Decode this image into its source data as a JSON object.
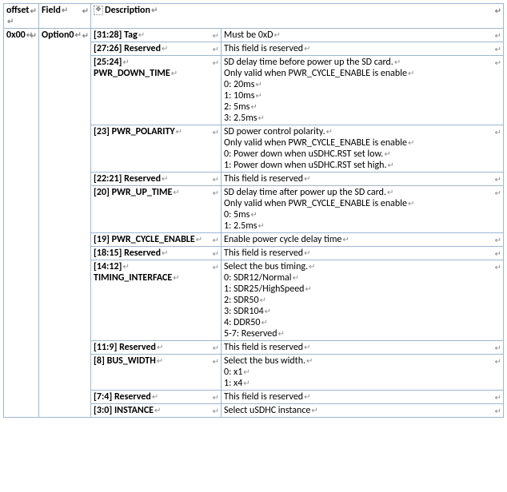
{
  "header": {
    "offset": "offset",
    "field": "Field",
    "description": "Description"
  },
  "row": {
    "offset": "0x00",
    "field": "Option0"
  },
  "bits": [
    {
      "field_lines": [
        "[31:28] Tag"
      ],
      "desc_lines": [
        "Must be 0xD"
      ]
    },
    {
      "field_lines": [
        "[27:26] Reserved"
      ],
      "desc_lines": [
        "This field is reserved"
      ]
    },
    {
      "field_lines": [
        "[25:24]",
        "PWR_DOWN_TIME"
      ],
      "desc_lines": [
        "SD delay time before power up the SD card.",
        "Only valid when PWR_CYCLE_ENABLE is enable",
        "0: 20ms",
        "1: 10ms",
        "2: 5ms",
        "3: 2.5ms"
      ]
    },
    {
      "field_lines": [
        "[23] PWR_POLARITY"
      ],
      "desc_lines": [
        "SD power control polarity.",
        "Only valid when PWR_CYCLE_ENABLE is enable",
        "0: Power down when uSDHC.RST set low.",
        "1: Power down when uSDHC.RST set high."
      ]
    },
    {
      "field_lines": [
        "[22:21] Reserved"
      ],
      "desc_lines": [
        "This field is reserved"
      ]
    },
    {
      "field_lines": [
        "[20] PWR_UP_TIME"
      ],
      "desc_lines": [
        "SD delay time after power up the SD card.",
        "Only valid when PWR_CYCLE_ENABLE is enable",
        "0: 5ms",
        "1: 2.5ms"
      ]
    },
    {
      "field_lines": [
        "[19] PWR_CYCLE_ENABLE"
      ],
      "desc_lines": [
        "Enable power cycle delay time"
      ]
    },
    {
      "field_lines": [
        "[18:15] Reserved"
      ],
      "desc_lines": [
        "This field is reserved"
      ]
    },
    {
      "field_lines": [
        "[14:12]",
        "TIMING_INTERFACE"
      ],
      "desc_lines": [
        "Select the bus timing.",
        "0: SDR12/Normal",
        "1: SDR25/HighSpeed",
        "2: SDR50",
        "3: SDR104",
        "4: DDR50",
        "5-7: Reserved"
      ]
    },
    {
      "field_lines": [
        "[11:9] Reserved"
      ],
      "desc_lines": [
        "This field is reserved"
      ]
    },
    {
      "field_lines": [
        "[8] BUS_WIDTH"
      ],
      "desc_lines": [
        "Select the bus width.",
        "0: x1",
        "1: x4"
      ]
    },
    {
      "field_lines": [
        "[7:4] Reserved"
      ],
      "desc_lines": [
        "This field is reserved"
      ]
    },
    {
      "field_lines": [
        "[3:0] INSTANCE"
      ],
      "desc_lines": [
        "Select uSDHC instance"
      ]
    }
  ]
}
